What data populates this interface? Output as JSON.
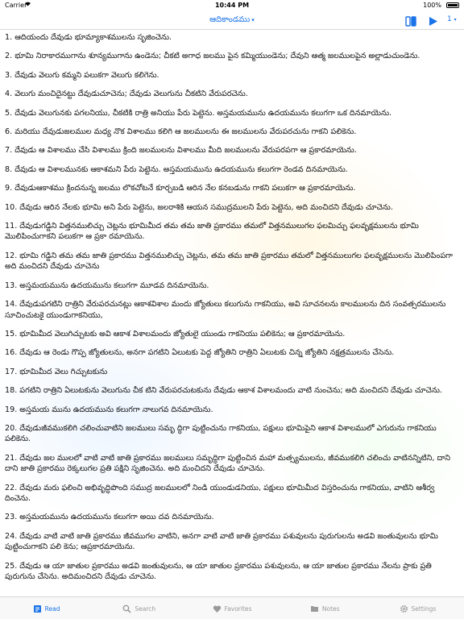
{
  "status_bar": {
    "carrier": "Carrier",
    "time": "10:44 PM",
    "battery": "100%"
  },
  "nav": {
    "title": "ఆదికాండము",
    "caret": "▾",
    "count": "1",
    "count_caret": "▾",
    "book_icon": "book-icon",
    "play_icon": "play-icon"
  },
  "verses": [
    "1. ఆదియందు దేవుడు భూమ్యాకాశములను సృజించెను.",
    "2. భూమి నిరాకారముగాను శూన్యముగాను ఉండెను; చీకటి అగాధ జలము పైన కమ్మియుండెను; దేవుని ఆత్మ జలములపైన అల్లాడుచుండెను.",
    "3. దేవుడు వెలుగు కమ్మని పలుకగా వెలుగు కలిగెను.",
    "4. వెలుగు మంచిదైనట్టు దేవుడుచూచెను; దేవుడు వెలుగును చీకటిని వేరుపరచెను.",
    "5. దేవుడు వెలుగునకు పగలనియు, చీకటికి రాత్రి అనియు పేరు పెట్టెను. అస్తమయమును ఉదయమును కలుగగా ఒక దినమాయెను.",
    "6. మరియు దేవుడుజలముల మధ్య నొక విశాలము కలిగి ఆ జలములను ఈ జలములను వేరుపరచును గాకని పలికెను.",
    "7. దేవుడు ఆ విశాలము చేసి విశాలము క్రింది జలములను విశాలము మీది జలములను వేరుపరపగా ఆ ప్రకారమాయెను.",
    "8. దేవుడు ఆ విశాలమునకు ఆకాశమని పేరు పెట్టెను. అస్తమయమును ఉదయమును కలుగగా రెండవ దినమాయెను.",
    "9. దేవుడుఆకాశము క్రిందనున్న జలము లొకచోటనే కూర్చబడి ఆరిన నేల కనబడును గాకని పలుకగా ఆ ప్రకారమాయెను.",
    "10. దేవుడు ఆరిన నేలకు భూమి అని పేరు పెట్టెను, జలరాశికి ఆయన సముద్రములని పేరు పెట్టెను, అది మంచిదని దేవుడు చూచెను.",
    "11. దేవుడుగడ్డిని విత్తనములిచ్చు చెట్లను భూమిమీద తమ తమ జాతి ప్రకారము తమలో విత్తనములుగల ఫలమిచ్చు ఫలవృక్షములను భూమి మొలిపించుగాకని పలుకగా ఆ ప్రకా రమాయెను.",
    "12. భూమి గడ్డిని తమ తమ జాతి ప్రకారము విత్తనములిచ్చు చెట్లను, తమ తమ జాతి ప్రకారము తమలో విత్తనములుగల ఫలవృక్షములను మొలిపింపగా అది మంచిదని దేవుడు చూచెను",
    "13. అస్తమయమును ఉదయమును కలుగగా మూడవ దినమాయెను.",
    "14. దేవుడుపగటిని రాత్రిని వేరుపరచునట్లు ఆకాశవిశాల మందు జ్యోతులు కలుగును గాకనియు, అవి సూచనలను కాలములను దిన సంవత్సరములను సూచించుటకై యుండుగాకనియు,",
    "15. భూమిమీద వెలుగిచ్చుటకు అవి ఆకాశ విశాలమందు జ్యోతులై యుండు గాకనియు పలికెను; ఆ ప్రకారమాయెను.",
    "16. దేవుడు ఆ రెండు గొప్ప జ్యోతులను, అనగా పగటిని ఏలుటకు పెద్ద జ్యోతిని రాత్రిని ఏలుటకు చిన్న జ్యోతిని నక్షత్రములను చేసెను.",
    "17. భూమిమీద వెలు గిచ్చుటకును",
    "18. పగటిని రాత్రిని ఏలుటకును వెలుగును చీక టిని వేరుపరచుటకును దేవుడు ఆకాశ విశాలమందు వాటి నుంచెను; అది మంచిదని దేవుడు చూచెను.",
    "19. అస్తమయ మును ఉదయమును కలుగగా నాలుగవ దినమాయెను.",
    "20. దేవుడుజీవముకలిగి చలించువాటిని జలములు సమృ ద్ధిగా పుట్టించును గాకనియు, పక్షులు భూమిపైని ఆకాశ విశాలములో ఎగురును గాకనియు పలికెను.",
    "21. దేవుడు జల ములలో వాటి వాటి జాతి ప్రకారము జలములు సమృద్ధిగా పుట్టించిన మహా మత్స్యములను, జీవముకలిగి చలించు వాటినన్నిటిని, దాని దాని జాతి ప్రకారము రెక్కలుగల ప్రతి పక్షిని సృజించెను. అది మంచిదని దేవుడు చూచెను.",
    "22. దేవుడు మరు ఫలించి అభివృద్ధిపొంది సముద్ర జలములలో నిండి యుండుడనియు, పక్షులు భూమిమీద విస్తరించును గాకనియు, వాటిని ఆశీర్వ దించెను.",
    "23. అస్తమయమును ఉదయమును కలుగగా అయి దవ దినమాయెను.",
    "24. దేవుడు వాటి వాటి జాతి ప్రకారము జీవముగల వాటిని, అనగా వాటి వాటి జాతి ప్రకారము పశువులను పురుగులను అడవి జంతువులను భూమి పుట్టించుగాకని పలి కెను; ఆప్రకారమాయెను.",
    "25. దేవుడు ఆ యా జాతుల ప్రకారము అడవి జంతువులను, ఆ యా జాతుల ప్రకారము పశువులను, ఆ యా జాతుల ప్రకారము నేలను ప్రాకు ప్రతి పురుగును చేసెను. అదిమంచిదని దేవుడు చూచెను."
  ],
  "tabs": [
    {
      "label": "Read",
      "icon": "read-icon",
      "active": true
    },
    {
      "label": "Search",
      "icon": "search-icon",
      "active": false
    },
    {
      "label": "Favorites",
      "icon": "heart-icon",
      "active": false
    },
    {
      "label": "Notes",
      "icon": "notes-icon",
      "active": false
    },
    {
      "label": "Settings",
      "icon": "gear-icon",
      "active": false
    }
  ],
  "colors": {
    "accent": "#1a73e8",
    "inactive": "#9a9a9a",
    "text": "#111111"
  }
}
